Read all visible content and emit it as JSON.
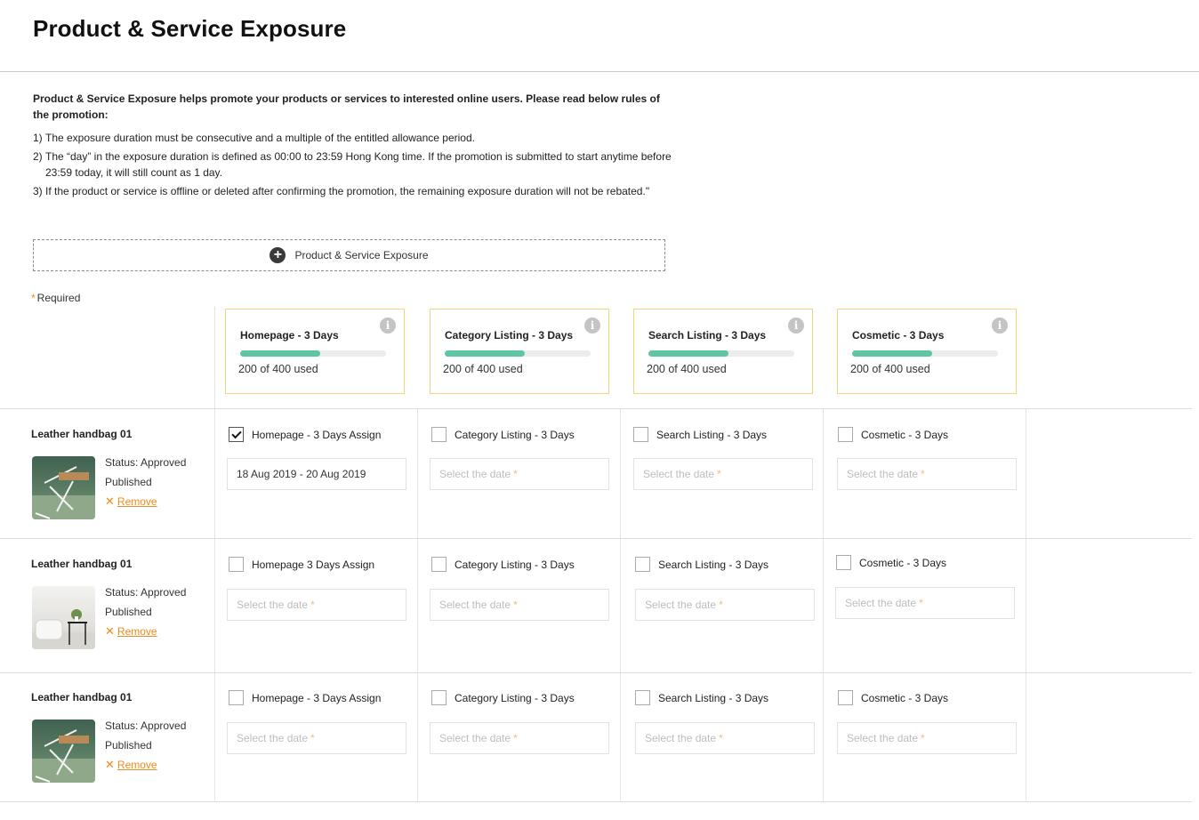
{
  "page": {
    "title": "Product & Service Exposure",
    "intro": "Product & Service Exposure helps promote your products or services to interested online users. Please read below rules of the promotion:",
    "rules": [
      {
        "num": "1)",
        "text": "The exposure duration must be consecutive and a multiple of the entitled allowance period."
      },
      {
        "num": "2)",
        "text": "The “day” in the  exposure duration is defined as 00:00 to 23:59 Hong Kong time. If the promotion is submitted to start anytime before 23:59 today, it will still count as 1 day."
      },
      {
        "num": "3)",
        "text": "If the product or service is offline or deleted after confirming the promotion, the remaining exposure duration will not be rebated.\""
      }
    ],
    "add_button": "Product & Service Exposure",
    "required_star": "*",
    "required_label": "Required"
  },
  "quotas": [
    {
      "title": "Homepage - 3 Days",
      "used": "200 of 400 used",
      "fraction": 0.55
    },
    {
      "title": "Category Listing - 3 Days",
      "used": "200 of 400 used",
      "fraction": 0.55
    },
    {
      "title": "Search Listing - 3 Days",
      "used": "200 of 400 used",
      "fraction": 0.55
    },
    {
      "title": "Cosmetic - 3 Days",
      "used": "200 of 400 used",
      "fraction": 0.55
    }
  ],
  "info_glyph": "i",
  "remove_glyph": "✕",
  "add_glyph": "+",
  "date_placeholder": "Select the date",
  "date_star": "*",
  "products": [
    {
      "name": "Leather handbag 01",
      "status": "Status: Approved",
      "published": "Published",
      "remove": "Remove",
      "options": [
        {
          "label": "Homepage - 3 Days Assign",
          "checked": true,
          "date": "18 Aug 2019 - 20 Aug 2019"
        },
        {
          "label": "Category Listing - 3 Days",
          "checked": false,
          "date": ""
        },
        {
          "label": "Search Listing - 3 Days",
          "checked": false,
          "date": ""
        },
        {
          "label": "Cosmetic - 3 Days",
          "checked": false,
          "date": ""
        }
      ]
    },
    {
      "name": "Leather handbag 01",
      "status": "Status: Approved",
      "published": "Published",
      "remove": "Remove",
      "options": [
        {
          "label": "Homepage 3 Days Assign",
          "checked": false,
          "date": ""
        },
        {
          "label": "Category Listing - 3 Days",
          "checked": false,
          "date": ""
        },
        {
          "label": "Search Listing - 3 Days",
          "checked": false,
          "date": ""
        },
        {
          "label": "Cosmetic - 3 Days",
          "checked": false,
          "date": ""
        }
      ]
    },
    {
      "name": "Leather handbag 01",
      "status": "Status: Approved",
      "published": "Published",
      "remove": "Remove",
      "options": [
        {
          "label": "Homepage - 3 Days Assign",
          "checked": false,
          "date": ""
        },
        {
          "label": "Category Listing - 3 Days",
          "checked": false,
          "date": ""
        },
        {
          "label": "Search Listing - 3 Days",
          "checked": false,
          "date": ""
        },
        {
          "label": "Cosmetic - 3 Days",
          "checked": false,
          "date": ""
        }
      ]
    }
  ]
}
